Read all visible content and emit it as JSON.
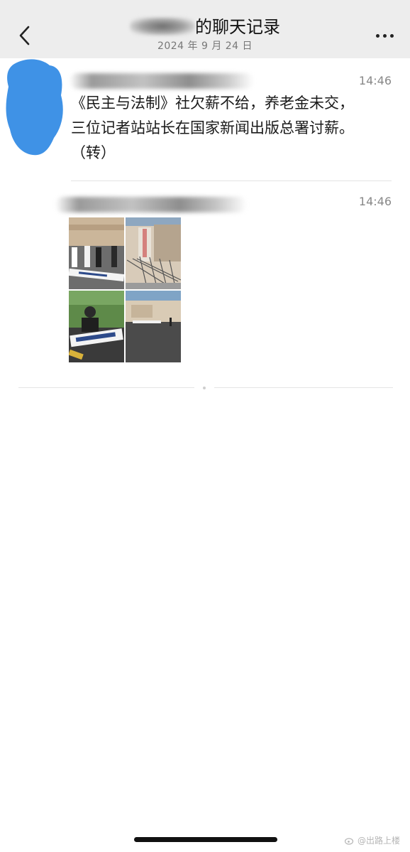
{
  "header": {
    "title_suffix": "的聊天记录",
    "date": "2024 年 9 月 24 日"
  },
  "messages": [
    {
      "time": "14:46",
      "text": "《民主与法制》社欠薪不给，养老金未交，\n三位记者站站长在国家新闻出版总署讨薪。\n（转）"
    },
    {
      "time": "14:46",
      "images": [
        "photo-men-with-banner",
        "photo-gate-sign",
        "photo-man-with-banner",
        "photo-building-street"
      ]
    }
  ],
  "colors": {
    "header_bg": "#ededed",
    "page_bg": "#ffffff",
    "avatar_scribble": "#3f92e6"
  },
  "watermark": {
    "text": "@出路上楼"
  }
}
